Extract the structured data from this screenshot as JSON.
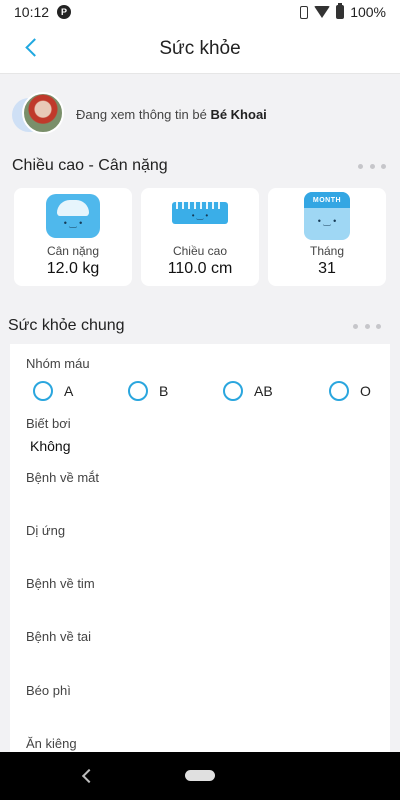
{
  "status_bar": {
    "time": "10:12",
    "notification_icon": "P",
    "battery": "100%"
  },
  "app_bar": {
    "title": "Sức khỏe"
  },
  "child": {
    "prefix": "Đang xem thông tin bé",
    "name": "Bé Khoai"
  },
  "growth": {
    "title": "Chiều cao - Cân nặng",
    "cards": [
      {
        "icon": "scale-icon",
        "label": "Cân nặng",
        "value": "12.0 kg"
      },
      {
        "icon": "ruler-icon",
        "label": "Chiều cao",
        "value": "110.0 cm"
      },
      {
        "icon": "calendar-icon",
        "icon_text": "MONTH",
        "label": "Tháng",
        "value": "31"
      }
    ]
  },
  "general": {
    "title": "Sức khỏe chung",
    "blood_type": {
      "label": "Nhóm máu",
      "options": [
        "A",
        "B",
        "AB",
        "O"
      ]
    },
    "fields": [
      {
        "label": "Biết bơi",
        "value": "Không"
      },
      {
        "label": "Bệnh về mắt",
        "value": ""
      },
      {
        "label": "Dị ứng",
        "value": ""
      },
      {
        "label": "Bệnh về tim",
        "value": ""
      },
      {
        "label": "Bệnh về tai",
        "value": ""
      },
      {
        "label": "Béo phì",
        "value": ""
      },
      {
        "label": "Ăn kiêng",
        "value": ""
      }
    ]
  },
  "colors": {
    "accent": "#20a8e0",
    "background": "#f2f2f4",
    "card": "#ffffff"
  }
}
